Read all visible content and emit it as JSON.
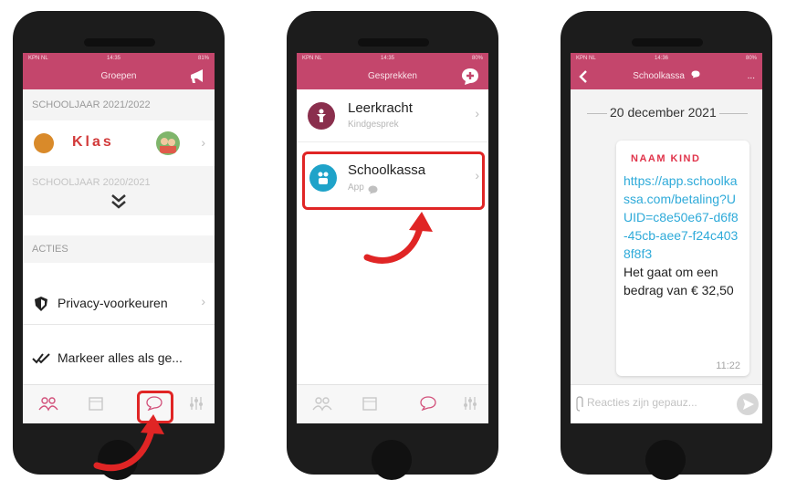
{
  "colors": {
    "brand": "#c4466c",
    "highlight": "#e02525",
    "link": "#2eaad9",
    "sender": "#e0334a"
  },
  "phone1": {
    "status": {
      "carrier": "KPN NL",
      "time": "14:35",
      "battery": "81%"
    },
    "nav_title": "Groepen",
    "nav_icon": "megaphone-icon",
    "section1": "SCHOOLJAAR 2021/2022",
    "group_name": "Klas",
    "section2": "SCHOOLJAAR 2020/2021",
    "expand_icon": "double-chevron-down-icon",
    "actions_header": "ACTIES",
    "privacy_label": "Privacy-voorkeuren",
    "mark_all_label": "Markeer alles als ge...",
    "tabs": [
      "groups-icon",
      "calendar-icon",
      "chat-icon",
      "settings-icon"
    ]
  },
  "phone2": {
    "status": {
      "carrier": "KPN NL",
      "time": "14:35",
      "battery": "80%"
    },
    "nav_title": "Gesprekken",
    "nav_icon": "add-icon",
    "conversations": [
      {
        "name": "Leerkracht",
        "subtitle": "Kindgesprek"
      },
      {
        "name": "Schoolkassa",
        "subtitle": "App"
      }
    ],
    "tabs": [
      "groups-icon",
      "calendar-icon",
      "chat-icon",
      "settings-icon"
    ]
  },
  "phone3": {
    "status": {
      "carrier": "KPN NL",
      "time": "14:36",
      "battery": "80%"
    },
    "nav_title": "Schoolkassa",
    "more_label": "...",
    "date": "20 december 2021",
    "sender": "NAAM KIND",
    "link": "https://app.schoolkassa.com/betaling?UUID=c8e50e67-d6f8-45cb-aee7-f24c4038f8f3",
    "message": "Het gaat om een bedrag van € 32,50",
    "time": "11:22",
    "input_placeholder": "Reacties zijn gepauz..."
  }
}
